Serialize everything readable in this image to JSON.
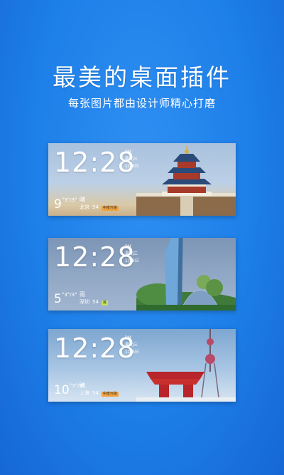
{
  "header": {
    "title": "最美的桌面插件",
    "subtitle": "每张图片都由设计师精心打磨"
  },
  "widgets": [
    {
      "time": "12:28",
      "ampm": "PM",
      "weekday": "星期三",
      "date": "1月8日",
      "temp": "9",
      "temp_unit": "°",
      "temp_range": "3°/3°",
      "weather": "晴",
      "city": "北京",
      "aqi": "54",
      "aqi_label": "中度污染",
      "aqi_color": "#f2a23c"
    },
    {
      "time": "12:28",
      "ampm": "PM",
      "weekday": "星期三",
      "date": "1月8日",
      "temp": "5",
      "temp_unit": "°",
      "temp_range": "3°/3°",
      "weather": "雨",
      "city": "深圳",
      "aqi": "54",
      "aqi_label": "良",
      "aqi_color": "#c8e05a"
    },
    {
      "time": "12:28",
      "ampm": "PM",
      "weekday": "星期三",
      "date": "1月8日",
      "temp": "10",
      "temp_unit": "°",
      "temp_range": "3°/3°",
      "weather": "晴",
      "city": "上海",
      "aqi": "54",
      "aqi_label": "中度污染",
      "aqi_color": "#f2a23c"
    }
  ],
  "colors": {
    "background": "#1d7fe8",
    "accent": "#ffffff"
  }
}
